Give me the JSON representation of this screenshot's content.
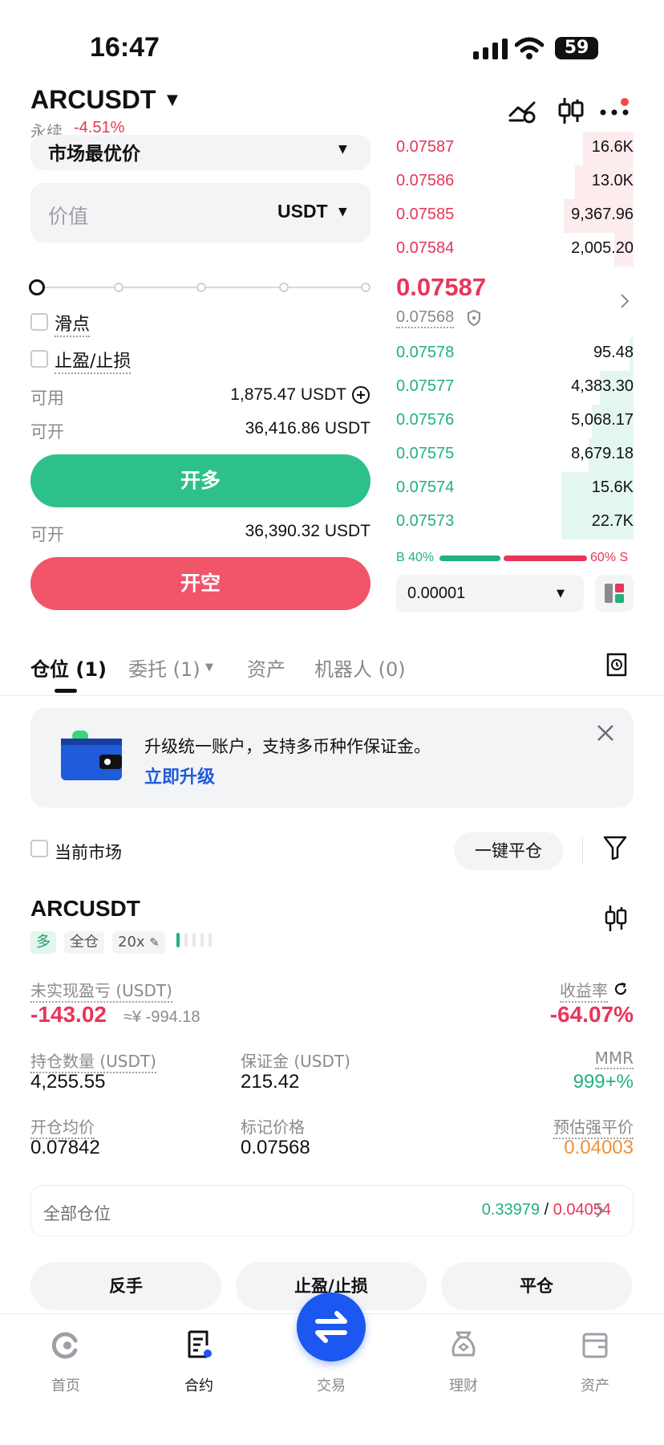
{
  "status": {
    "time": "16:47",
    "battery": "59"
  },
  "header": {
    "pair": "ARCUSDT",
    "type": "永续",
    "change": "-4.51%"
  },
  "form": {
    "order_type": "市场最优价",
    "value_placeholder": "价值",
    "value_unit": "USDT",
    "slippage_label": "滑点",
    "tpsl_label": "止盈/止损",
    "available_label": "可用",
    "available_value": "1,875.47 USDT",
    "open_label": "可开",
    "open_long_value": "36,416.86 USDT",
    "long_button": "开多",
    "open_short_value": "36,390.32 USDT",
    "short_button": "开空"
  },
  "orderbook": {
    "asks": [
      {
        "price": "0.07587",
        "qty": "16.6K",
        "depth": 0.36
      },
      {
        "price": "0.07586",
        "qty": "13.0K",
        "depth": 0.42
      },
      {
        "price": "0.07585",
        "qty": "9,367.96",
        "depth": 0.5
      },
      {
        "price": "0.07584",
        "qty": "2,005.20",
        "depth": 0.14
      }
    ],
    "last_price": "0.07587",
    "mark_price": "0.07568",
    "bids": [
      {
        "price": "0.07578",
        "qty": "95.48",
        "depth": 0.03
      },
      {
        "price": "0.07577",
        "qty": "4,383.30",
        "depth": 0.24
      },
      {
        "price": "0.07576",
        "qty": "5,068.17",
        "depth": 0.3
      },
      {
        "price": "0.07575",
        "qty": "8,679.18",
        "depth": 0.32
      },
      {
        "price": "0.07574",
        "qty": "15.6K",
        "depth": 0.52
      },
      {
        "price": "0.07573",
        "qty": "22.7K",
        "depth": 0.52
      }
    ],
    "buy_ratio": "B 40%",
    "sell_ratio": "60% S",
    "precision": "0.00001",
    "buy_share": 0.4
  },
  "tabs": [
    {
      "label": "仓位 (1)"
    },
    {
      "label": "委托 (1)"
    },
    {
      "label": "资产"
    },
    {
      "label": "机器人 (0)"
    }
  ],
  "banner": {
    "text": "升级统一账户，支持多币种作保证金。",
    "link": "立即升级"
  },
  "filter": {
    "current_market": "当前市场",
    "close_all": "一键平仓"
  },
  "position": {
    "symbol": "ARCUSDT",
    "tags": [
      "多",
      "全仓",
      "20x"
    ],
    "unrealized_label": "未实现盈亏 (USDT)",
    "unrealized_value": "-143.02",
    "unrealized_cny": "≈¥ -994.18",
    "roe_label": "收益率",
    "roe_value": "-64.07%",
    "size_label": "持仓数量 (USDT)",
    "size_value": "4,255.55",
    "margin_label": "保证金 (USDT)",
    "margin_value": "215.42",
    "mmr_label": "MMR",
    "mmr_value": "999+%",
    "entry_label": "开仓均价",
    "entry_value": "0.07842",
    "mark_label": "标记价格",
    "mark_value": "0.07568",
    "liq_label": "预估强平价",
    "liq_value": "0.04003",
    "all_positions_label": "全部仓位",
    "all_positions_green": "0.33979",
    "all_positions_sep": "/",
    "all_positions_red": "0.04054",
    "actions": [
      "反手",
      "止盈/止损",
      "平仓"
    ]
  },
  "nav": [
    {
      "label": "首页",
      "icon": "home-icon"
    },
    {
      "label": "合约",
      "icon": "contract-icon"
    },
    {
      "label": "交易",
      "icon": "swap-icon"
    },
    {
      "label": "理财",
      "icon": "earn-icon"
    },
    {
      "label": "资产",
      "icon": "wallet-icon"
    }
  ],
  "colors": {
    "green": "#22b07d",
    "red": "#e8355a",
    "blue": "#1b57f0",
    "orange": "#f0903a"
  }
}
